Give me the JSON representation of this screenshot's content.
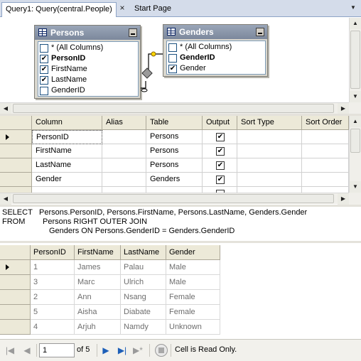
{
  "tabs": {
    "active_label": "Query1: Query(central.People)",
    "inactive_label": "Start Page",
    "close_glyph": "×",
    "dropdown_glyph": "▼"
  },
  "diagram": {
    "persons": {
      "title": "Persons",
      "rows": [
        {
          "label": "* (All Columns)",
          "checked": false,
          "key": false
        },
        {
          "label": "PersonID",
          "checked": true,
          "key": true
        },
        {
          "label": "FirstName",
          "checked": true,
          "key": false
        },
        {
          "label": "LastName",
          "checked": true,
          "key": false
        },
        {
          "label": "GenderID",
          "checked": false,
          "key": false
        }
      ]
    },
    "genders": {
      "title": "Genders",
      "rows": [
        {
          "label": "* (All Columns)",
          "checked": false,
          "key": false
        },
        {
          "label": "GenderID",
          "checked": false,
          "key": true
        },
        {
          "label": "Gender",
          "checked": true,
          "key": false
        }
      ]
    }
  },
  "criteria": {
    "headers": [
      "Column",
      "Alias",
      "Table",
      "Output",
      "Sort Type",
      "Sort Order"
    ],
    "rows": [
      {
        "column": "PersonID",
        "alias": "",
        "table": "Persons",
        "output": true
      },
      {
        "column": "FirstName",
        "alias": "",
        "table": "Persons",
        "output": true
      },
      {
        "column": "LastName",
        "alias": "",
        "table": "Persons",
        "output": true
      },
      {
        "column": "Gender",
        "alias": "",
        "table": "Genders",
        "output": true
      }
    ]
  },
  "sql": {
    "line1_kw": "SELECT",
    "line1_text": "Persons.PersonID, Persons.FirstName, Persons.LastName, Genders.Gender",
    "line2_kw": "FROM",
    "line2_text": "Persons RIGHT OUTER JOIN",
    "line3_text": "Genders ON Persons.GenderID = Genders.GenderID"
  },
  "results": {
    "headers": [
      "PersonID",
      "FirstName",
      "LastName",
      "Gender"
    ],
    "rows": [
      [
        "1",
        "James",
        "Palau",
        "Male"
      ],
      [
        "3",
        "Marc",
        "Ulrich",
        "Male"
      ],
      [
        "2",
        "Ann",
        "Nsang",
        "Female"
      ],
      [
        "5",
        "Aisha",
        "Diabate",
        "Female"
      ],
      [
        "4",
        "Arjuh",
        "Namdy",
        "Unknown"
      ]
    ]
  },
  "navigator": {
    "current_record": "1",
    "of_label": "of 5",
    "status": "Cell is Read Only.",
    "icons": [
      "first-record-icon",
      "previous-record-icon",
      "next-record-icon",
      "last-record-icon",
      "new-record-icon",
      "stop-icon"
    ]
  }
}
